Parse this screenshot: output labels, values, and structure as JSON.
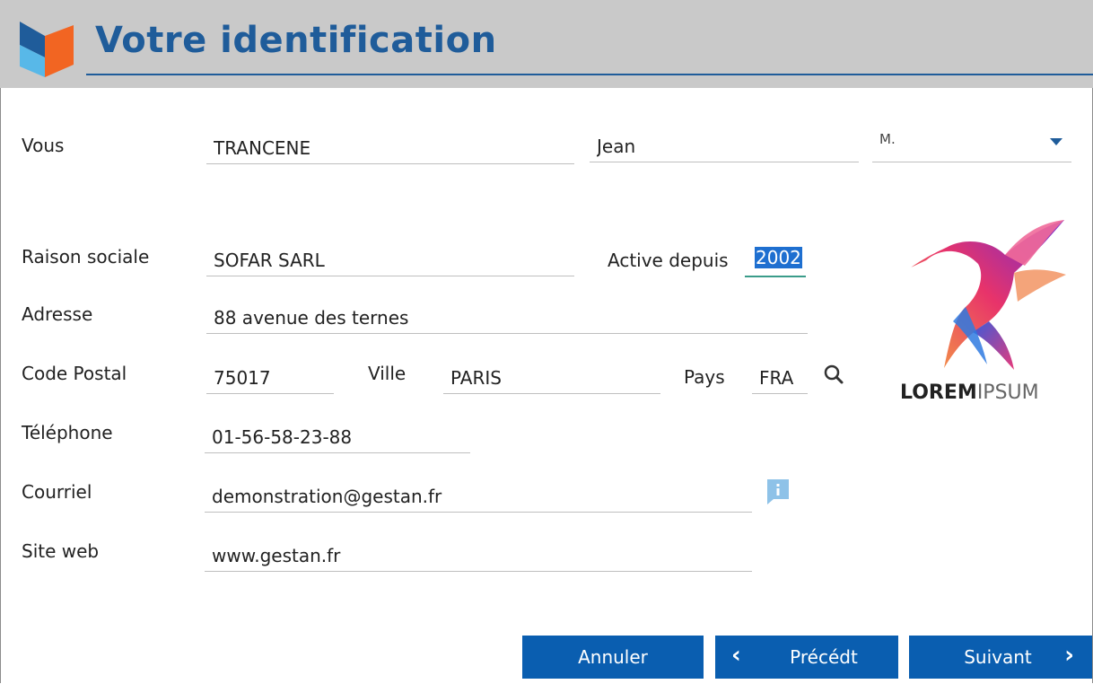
{
  "header": {
    "title": "Votre identification"
  },
  "form": {
    "vous": {
      "label": "Vous",
      "nom": "TRANCENE",
      "prenom": "Jean",
      "civilite": "M."
    },
    "raison_sociale": {
      "label": "Raison sociale",
      "value": "SOFAR SARL"
    },
    "active_depuis": {
      "label": "Active depuis",
      "value": "2002"
    },
    "adresse": {
      "label": "Adresse",
      "value": "88 avenue des ternes"
    },
    "code_postal": {
      "label": "Code Postal",
      "value": "75017"
    },
    "ville": {
      "label": "Ville",
      "value": "PARIS"
    },
    "pays": {
      "label": "Pays",
      "value": "FRA"
    },
    "telephone": {
      "label": "Téléphone",
      "value": "01-56-58-23-88"
    },
    "courriel": {
      "label": "Courriel",
      "value": "demonstration@gestan.fr"
    },
    "site_web": {
      "label": "Site web",
      "value": "www.gestan.fr"
    }
  },
  "brand": {
    "bold": "LOREM",
    "light": "IPSUM"
  },
  "buttons": {
    "annuler": "Annuler",
    "precedent": "Précédt",
    "suivant": "Suivant"
  },
  "icons": {
    "search": "search-icon",
    "info": "info-icon",
    "dropdown": "chevron-down-icon"
  },
  "colors": {
    "accent": "#1f5c9a",
    "button": "#0a5eb0",
    "header_bg": "#c9c9c9"
  }
}
